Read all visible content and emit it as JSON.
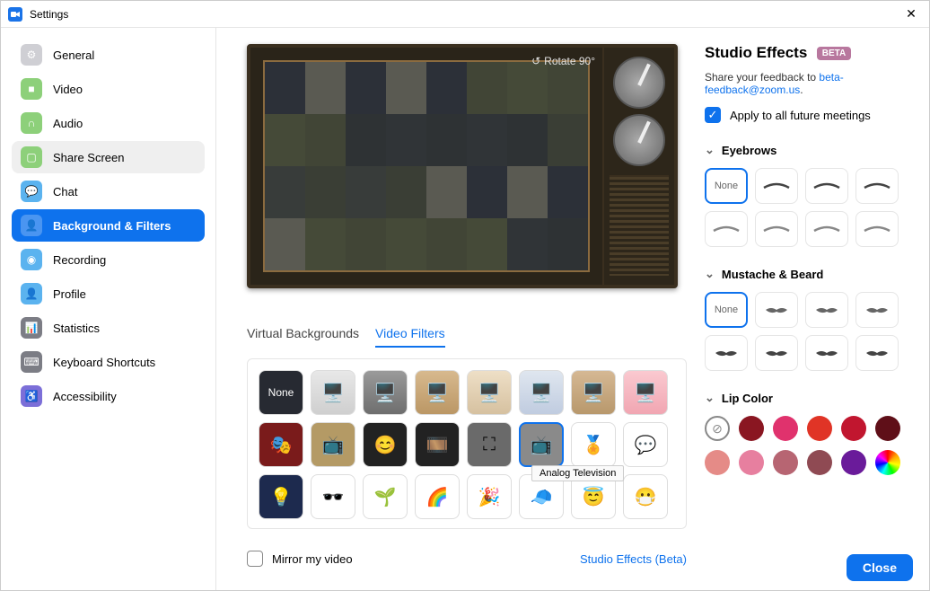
{
  "window": {
    "title": "Settings"
  },
  "sidebar": {
    "items": [
      {
        "id": "general",
        "label": "General"
      },
      {
        "id": "video",
        "label": "Video"
      },
      {
        "id": "audio",
        "label": "Audio"
      },
      {
        "id": "share-screen",
        "label": "Share Screen"
      },
      {
        "id": "chat",
        "label": "Chat"
      },
      {
        "id": "background-filters",
        "label": "Background & Filters"
      },
      {
        "id": "recording",
        "label": "Recording"
      },
      {
        "id": "profile",
        "label": "Profile"
      },
      {
        "id": "statistics",
        "label": "Statistics"
      },
      {
        "id": "keyboard-shortcuts",
        "label": "Keyboard Shortcuts"
      },
      {
        "id": "accessibility",
        "label": "Accessibility"
      }
    ],
    "active": "background-filters",
    "hovered": "share-screen"
  },
  "preview": {
    "rotate_label": "Rotate 90°"
  },
  "tabs": {
    "items": [
      "Virtual Backgrounds",
      "Video Filters"
    ],
    "active": 1
  },
  "filters": {
    "none_label": "None",
    "selected_index": 13,
    "tooltip": "Analog Television",
    "tiles": [
      {
        "name": "none",
        "bg": "#272a32",
        "gly": ""
      },
      {
        "name": "original",
        "bg": "linear-gradient(#e8e8e8,#cfcfcf)",
        "gly": "🖥️"
      },
      {
        "name": "bw",
        "bg": "linear-gradient(#9a9a9a,#6e6e6e)",
        "gly": "🖥️"
      },
      {
        "name": "sepia",
        "bg": "linear-gradient(#d7b98e,#bb9765)",
        "gly": "🖥️"
      },
      {
        "name": "warm",
        "bg": "linear-gradient(#eedfc6,#d6c1a0)",
        "gly": "🖥️"
      },
      {
        "name": "cool",
        "bg": "linear-gradient(#dfe6ef,#c0cce0)",
        "gly": "🖥️"
      },
      {
        "name": "tan",
        "bg": "linear-gradient(#d5b894,#b8986c)",
        "gly": "🖥️"
      },
      {
        "name": "pink",
        "bg": "linear-gradient(#fac9d0,#f1a6b2)",
        "gly": "🖥️"
      },
      {
        "name": "theater",
        "bg": "#7a1b1b",
        "gly": "🎭"
      },
      {
        "name": "tv-color",
        "bg": "#b49a65",
        "gly": "📺"
      },
      {
        "name": "emoji-frame",
        "bg": "#222",
        "gly": "😊"
      },
      {
        "name": "film-frame",
        "bg": "#222",
        "gly": "🎞️"
      },
      {
        "name": "target",
        "bg": "#6a6a6a",
        "gly": "⛶"
      },
      {
        "name": "analog-tv",
        "bg": "#8a8a8a",
        "gly": "📺"
      },
      {
        "name": "ribbon",
        "bg": "#fff",
        "gly": "🏅"
      },
      {
        "name": "speech",
        "bg": "#fff",
        "gly": "💬"
      },
      {
        "name": "lights",
        "bg": "#1d2a4e",
        "gly": "💡"
      },
      {
        "name": "deal-glasses",
        "bg": "#fff",
        "gly": "🕶️"
      },
      {
        "name": "sprout",
        "bg": "#fff",
        "gly": "🌱"
      },
      {
        "name": "rainbow",
        "bg": "#fff",
        "gly": "🌈"
      },
      {
        "name": "party-hat",
        "bg": "#fff",
        "gly": "🎉"
      },
      {
        "name": "cap",
        "bg": "#fff",
        "gly": "🧢"
      },
      {
        "name": "halo",
        "bg": "#fff",
        "gly": "😇"
      },
      {
        "name": "mask",
        "bg": "#fff",
        "gly": "😷"
      }
    ]
  },
  "mirror": {
    "label": "Mirror my video",
    "checked": false
  },
  "studio_link": "Studio Effects (Beta)",
  "studio": {
    "title": "Studio Effects",
    "beta_badge": "BETA",
    "feedback_prefix": "Share your feedback to",
    "feedback_email": "beta-feedback@zoom.us",
    "apply_label": "Apply to all future meetings",
    "apply_checked": true,
    "sections": {
      "eyebrows": {
        "title": "Eyebrows",
        "none_label": "None",
        "items": [
          "none",
          "brow-1",
          "brow-2",
          "brow-3",
          "brow-4",
          "brow-5",
          "brow-6",
          "brow-7"
        ]
      },
      "mustache": {
        "title": "Mustache & Beard",
        "none_label": "None",
        "items": [
          "none",
          "mus-1",
          "mus-2",
          "mus-3",
          "mus-4",
          "mus-5",
          "mus-6",
          "mus-7"
        ]
      },
      "lipcolor": {
        "title": "Lip Color",
        "colors": [
          "none",
          "#8a1621",
          "#e0326d",
          "#e03426",
          "#c1162f",
          "#5f0f18",
          "#e58b87",
          "#e77f9f",
          "#b76572",
          "#8f4a53",
          "#6a1b9a",
          "rainbow"
        ]
      }
    }
  },
  "close_button": "Close"
}
